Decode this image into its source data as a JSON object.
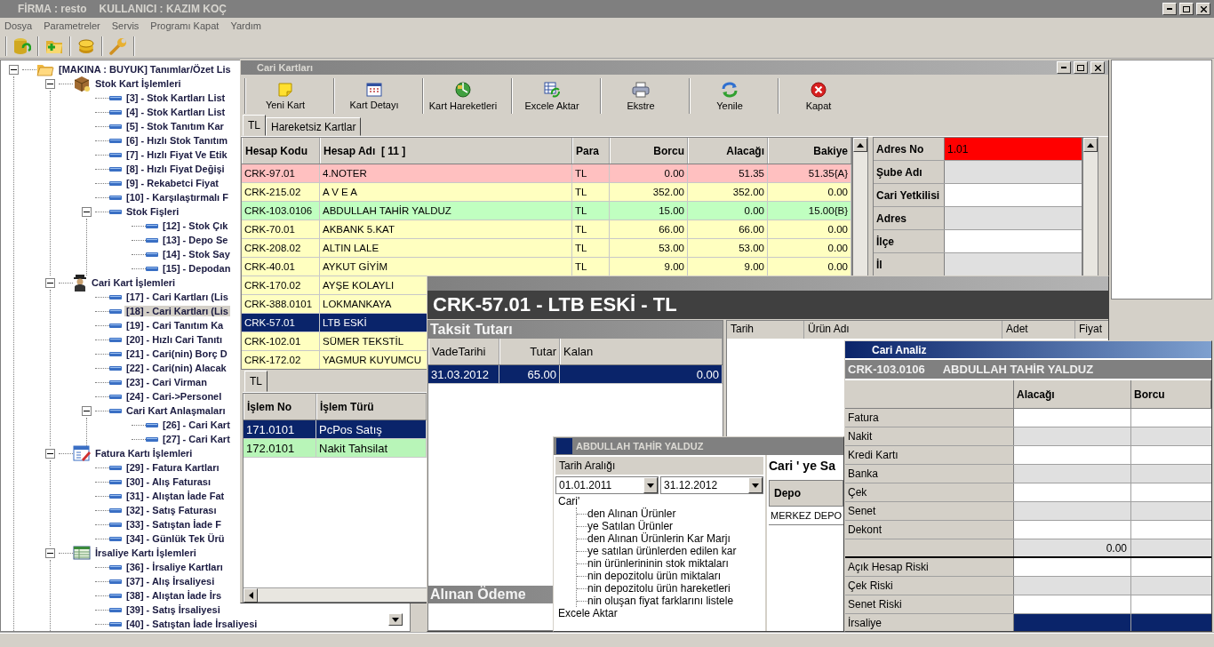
{
  "app": {
    "firm": "FİRMA : resto",
    "user": "KULLANICI : KAZIM KOÇ"
  },
  "menu": [
    "Dosya",
    "Parametreler",
    "Servis",
    "Programı Kapat",
    "Yardım"
  ],
  "tree": {
    "label": "[MAKINA : BUYUK] Tanımlar/Özet Lis",
    "kind": "root",
    "expanded": true,
    "selected": false,
    "children": [
      {
        "label": "Stok Kart İşlemleri",
        "kind": "section",
        "expanded": true,
        "selected": false,
        "children": [
          {
            "label": "[3] - Stok Kartları List",
            "selected": false
          },
          {
            "label": "[4] - Stok Kartları List",
            "selected": false
          },
          {
            "label": "[5] - Stok Tanıtım Kar",
            "selected": false
          },
          {
            "label": "[6] - Hızlı Stok Tanıtım",
            "selected": false
          },
          {
            "label": "[7] - Hızlı Fiyat Ve Etik",
            "selected": false
          },
          {
            "label": "[8] - Hızlı Fiyat Değişi",
            "selected": false
          },
          {
            "label": "[9] - Rekabetci Fiyat",
            "selected": false
          },
          {
            "label": "[10] - Karşılaştırmalı F",
            "selected": false
          },
          {
            "label": "Stok Fişleri",
            "expanded": true,
            "selected": false,
            "children": [
              {
                "label": "[12] - Stok Çık",
                "selected": false
              },
              {
                "label": "[13] - Depo Se",
                "selected": false
              },
              {
                "label": "[14] - Stok Say",
                "selected": false
              },
              {
                "label": "[15] - Depodan",
                "selected": false
              }
            ]
          }
        ]
      },
      {
        "label": "Cari Kart İşlemleri",
        "kind": "section",
        "expanded": true,
        "selected": false,
        "children": [
          {
            "label": "[17] - Cari Kartları (Lis",
            "selected": false
          },
          {
            "label": "[18] - Cari Kartları (Lis",
            "selected": true
          },
          {
            "label": "[19] - Cari Tanıtım Ka",
            "selected": false
          },
          {
            "label": "[20] - Hızlı Cari Tanıtı",
            "selected": false
          },
          {
            "label": "[21] - Cari(nin) Borç D",
            "selected": false
          },
          {
            "label": "[22] - Cari(nin) Alacak",
            "selected": false
          },
          {
            "label": "[23] - Cari Virman",
            "selected": false
          },
          {
            "label": "[24] - Cari->Personel",
            "selected": false
          },
          {
            "label": "Cari Kart Anlaşmaları",
            "expanded": true,
            "selected": false,
            "children": [
              {
                "label": "[26] - Cari Kart",
                "selected": false
              },
              {
                "label": "[27] - Cari Kart",
                "selected": false
              }
            ]
          }
        ]
      },
      {
        "label": "Fatura Kartı İşlemleri",
        "kind": "section",
        "expanded": true,
        "selected": false,
        "children": [
          {
            "label": "[29] - Fatura Kartları",
            "selected": false
          },
          {
            "label": "[30] - Alış Faturası",
            "selected": false
          },
          {
            "label": "[31] - Alıştan İade Fat",
            "selected": false
          },
          {
            "label": "[32] - Satış Faturası",
            "selected": false
          },
          {
            "label": "[33] - Satıştan İade F",
            "selected": false
          },
          {
            "label": "[34] - Günlük Tek Ürü",
            "selected": false
          }
        ]
      },
      {
        "label": "İrsaliye Kartı İşlemleri",
        "kind": "section",
        "expanded": true,
        "selected": false,
        "children": [
          {
            "label": "[36] - İrsaliye Kartları",
            "selected": false
          },
          {
            "label": "[37] - Alış İrsaliyesi",
            "selected": false
          },
          {
            "label": "[38] - Alıştan İade İrs",
            "selected": false
          },
          {
            "label": "[39] - Satış İrsaliyesi",
            "selected": false
          },
          {
            "label": "[40] - Satıştan İade İrsaliyesi",
            "selected": false
          }
        ]
      }
    ]
  },
  "cari_kartlari": {
    "title": "Cari Kartları",
    "toolbar": [
      "Yeni Kart",
      "Kart Detayı",
      "Kart Hareketleri",
      "Excele Aktar",
      "Ekstre",
      "Yenile",
      "Kapat"
    ],
    "tabs": [
      {
        "label": "TL",
        "selected": true
      },
      {
        "label": "Hareketsiz Kartlar",
        "selected": false
      }
    ],
    "columns": [
      "Hesap Kodu",
      "Hesap Adı  [ 11 ]",
      "Para",
      "Borcu",
      "Alacağı",
      "Bakiye"
    ],
    "rows": [
      {
        "color": "#ffc0c0",
        "selected": false,
        "cells": [
          "CRK-97.01",
          "4.NOTER",
          "TL",
          "0.00",
          "51.35",
          "51.35{A}"
        ]
      },
      {
        "color": "#ffffc0",
        "selected": false,
        "cells": [
          "CRK-215.02",
          "A V E A",
          "TL",
          "352.00",
          "352.00",
          "0.00"
        ]
      },
      {
        "color": "#c0ffc0",
        "selected": false,
        "cells": [
          "CRK-103.0106",
          "ABDULLAH TAHİR YALDUZ",
          "TL",
          "15.00",
          "0.00",
          "15.00{B}"
        ]
      },
      {
        "color": "#ffffc0",
        "selected": false,
        "cells": [
          "CRK-70.01",
          "AKBANK 5.KAT",
          "TL",
          "66.00",
          "66.00",
          "0.00"
        ]
      },
      {
        "color": "#ffffc0",
        "selected": false,
        "cells": [
          "CRK-208.02",
          "ALTIN LALE",
          "TL",
          "53.00",
          "53.00",
          "0.00"
        ]
      },
      {
        "color": "#ffffc0",
        "selected": false,
        "cells": [
          "CRK-40.01",
          "AYKUT GİYİM",
          "TL",
          "9.00",
          "9.00",
          "0.00"
        ]
      },
      {
        "color": "#ffffc0",
        "selected": false,
        "cells": [
          "CRK-170.02",
          "AYŞE KOLAYLI"
        ]
      },
      {
        "color": "#ffffc0",
        "selected": false,
        "cells": [
          "CRK-388.0101",
          "LOKMANKAYA"
        ]
      },
      {
        "color": "#0a246a",
        "selected": true,
        "cells": [
          "CRK-57.01",
          "LTB ESKİ"
        ]
      },
      {
        "color": "#ffffc0",
        "selected": false,
        "cells": [
          "CRK-102.01",
          "SÜMER TEKSTİL"
        ]
      },
      {
        "color": "#ffffc0",
        "selected": false,
        "cells": [
          "CRK-172.02",
          "YAGMUR KUYUMCU"
        ]
      }
    ],
    "details": [
      {
        "label": "Adres No",
        "value": "1.01",
        "selected": true
      },
      {
        "label": "Şube Adı",
        "selected": false
      },
      {
        "label": "Cari Yetkilisi",
        "selected": false
      },
      {
        "label": "Adres",
        "selected": false
      },
      {
        "label": "İlçe",
        "selected": false
      },
      {
        "label": "İl",
        "selected": false
      }
    ],
    "lower_tabs": [
      {
        "label": "TL",
        "selected": true
      }
    ],
    "lower_columns": [
      "İşlem No",
      "İşlem Türü"
    ],
    "lower_rows": [
      {
        "color": "#0a246a",
        "selected": true,
        "cells": [
          "171.0101",
          "PcPos Satış"
        ]
      },
      {
        "color": "#b8f5b8",
        "selected": false,
        "cells": [
          "172.0101",
          "Nakit Tahsilat"
        ]
      }
    ]
  },
  "taksit": {
    "heading": "CRK-57.01 - LTB ESKİ - TL",
    "panel_title": "Taksit Tutarı",
    "columns": [
      "VadeTarihi",
      "Tutar",
      "Kalan"
    ],
    "rows": [
      {
        "selected": true,
        "cells": [
          "31.03.2012",
          "65.00",
          "0.00"
        ]
      }
    ],
    "footer_title": "Alınan Ödeme",
    "right_columns": [
      "Tarih",
      "Ürün Adı",
      "Adet",
      "Fiyat"
    ]
  },
  "analiz_window": {
    "title": "ABDULLAH TAHİR YALDUZ",
    "range_label": "Tarih Aralığı",
    "date_from": "01.01.2011",
    "date_to": "31.12.2012",
    "tree": {
      "label": "Cari'",
      "children": [
        "den Alınan Ürünler",
        "ye Satılan Ürünler",
        "den Alınan Ürünlerin Kar Marjı",
        "ye satılan ürünlerden edilen kar",
        "nin ürünlerininin stok miktaları",
        "nin depozitolu ürün miktaları",
        "nin depozitolu ürün hareketleri",
        "nin oluşan fiyat farklarını listele"
      ]
    },
    "export": "Excele Aktar",
    "side_title": "Cari ' ye Sa",
    "side_columns": [
      "Depo"
    ],
    "side_rows": [
      "MERKEZ DEPO"
    ]
  },
  "cari_analiz": {
    "title": "Cari Analiz",
    "code": "CRK-103.0106",
    "name": "ABDULLAH TAHİR YALDUZ",
    "columns": [
      "Alacağı",
      "Borcu"
    ],
    "rows": [
      {
        "label": "Fatura",
        "selected": false
      },
      {
        "label": "Nakit",
        "selected": false
      },
      {
        "label": "Kredi Kartı",
        "selected": false
      },
      {
        "label": "Banka",
        "selected": false
      },
      {
        "label": "Çek",
        "selected": false
      },
      {
        "label": "Senet",
        "selected": false
      },
      {
        "label": "Dekont",
        "selected": false
      },
      {
        "kind": "total",
        "alacagi": "0.00",
        "selected": false
      },
      {
        "label": "Açık Hesap Riski",
        "selected": false
      },
      {
        "label": "Çek Riski",
        "selected": false
      },
      {
        "label": "Senet Riski",
        "selected": false
      },
      {
        "label": "İrsaliye",
        "selected": true
      }
    ]
  }
}
